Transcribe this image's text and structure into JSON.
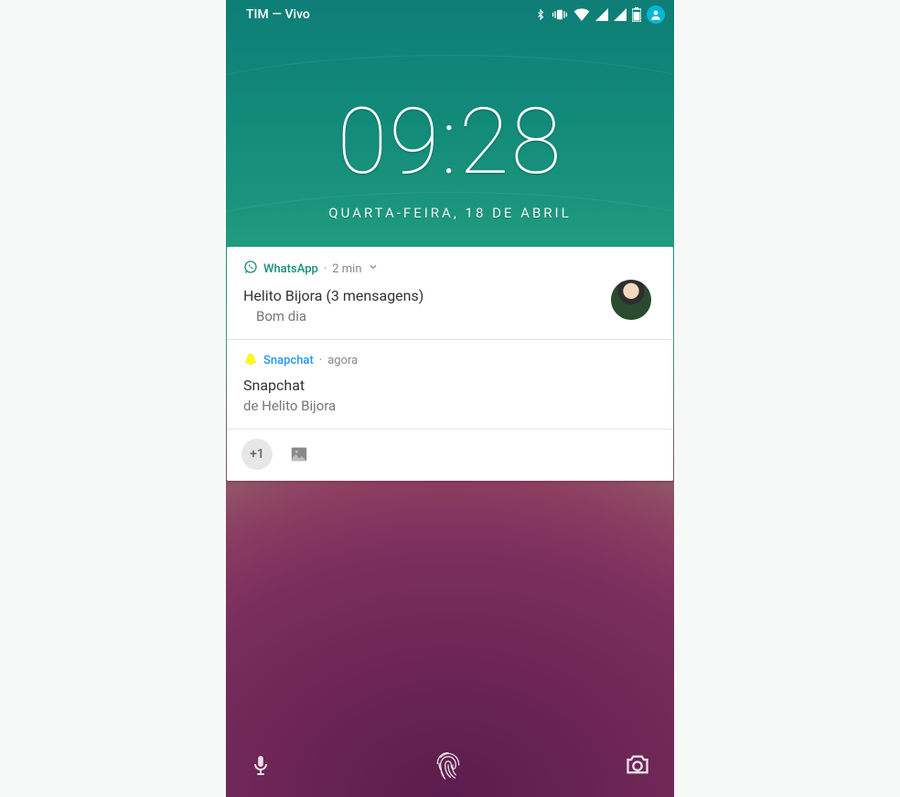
{
  "status_bar": {
    "carrier": "TIM — Vivo"
  },
  "clock": {
    "time": "09:28",
    "date": "QUARTA-FEIRA, 18 DE ABRIL"
  },
  "notifications": [
    {
      "app": "WhatsApp",
      "time": "2 min",
      "title": "Helito Bijora (3 mensagens)",
      "body": "Bom dia"
    },
    {
      "app": "Snapchat",
      "time": "agora",
      "title": "Snapchat",
      "body": "de Helito Bijora"
    }
  ],
  "overflow": {
    "count_label": "+1"
  }
}
